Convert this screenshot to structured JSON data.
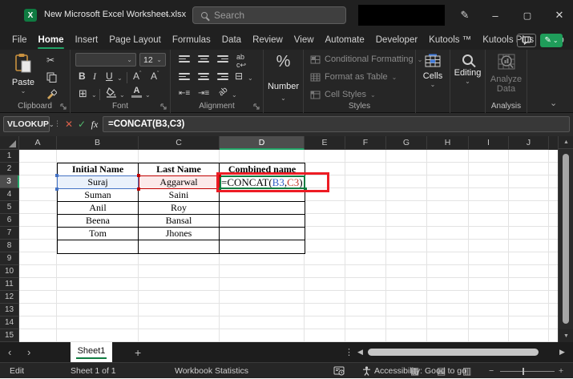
{
  "window": {
    "title": "New Microsoft Excel Worksheet.xlsx",
    "search_placeholder": "Search"
  },
  "menu": {
    "items": [
      "File",
      "Home",
      "Insert",
      "Page Layout",
      "Formulas",
      "Data",
      "Review",
      "View",
      "Automate",
      "Developer",
      "Kutools ™",
      "Kutools Plus",
      "Help"
    ],
    "active": "Home"
  },
  "ribbon": {
    "clipboard": {
      "label": "Clipboard",
      "paste": "Paste"
    },
    "font": {
      "label": "Font",
      "size": "12",
      "bold": "B",
      "italic": "I",
      "underline": "U"
    },
    "alignment": {
      "label": "Alignment"
    },
    "number": {
      "label": "Number",
      "percent": "%"
    },
    "styles": {
      "label": "Styles",
      "items": [
        "Conditional Formatting",
        "Format as Table",
        "Cell Styles"
      ]
    },
    "cells": {
      "label": "Cells"
    },
    "editing": {
      "label": "Editing"
    },
    "analysis": {
      "label": "Analysis",
      "analyze_line1": "Analyze",
      "analyze_line2": "Data"
    }
  },
  "formula_bar": {
    "name_box": "VLOOKUP",
    "fx": "fx",
    "formula": "=CONCAT(B3,C3)"
  },
  "grid": {
    "columns": [
      "A",
      "B",
      "C",
      "D",
      "E",
      "F",
      "G",
      "H",
      "I",
      "J"
    ],
    "selected_column": "D",
    "rows": [
      "1",
      "2",
      "3",
      "4",
      "5",
      "6",
      "7",
      "8",
      "9",
      "10",
      "11",
      "12",
      "13",
      "14",
      "15"
    ],
    "selected_row": "3"
  },
  "table": {
    "headers": [
      "Initial Name",
      "Last Name",
      "Combined name"
    ],
    "rows": [
      [
        "Suraj",
        "Aggarwal"
      ],
      [
        "Suman",
        "Saini"
      ],
      [
        "Anil",
        "Roy"
      ],
      [
        "Beena",
        "Bansal"
      ],
      [
        "Tom",
        "Jhones"
      ],
      [
        "",
        ""
      ]
    ],
    "formula_parts": {
      "prefix": "=CONCAT(",
      "ref1": "B3",
      "comma": ",",
      "ref2": "C3",
      "suffix": ")"
    }
  },
  "sheet_tabs": {
    "active": "Sheet1",
    "add_label": "+"
  },
  "status_bar": {
    "mode": "Edit",
    "sheet_info": "Sheet 1 of 1",
    "workbook_statistics": "Workbook Statistics",
    "accessibility": "Accessibility: Good to go"
  },
  "colors": {
    "accent_green": "#107c41",
    "menu_green": "#21a366",
    "ref_blue": "#2e5cc5",
    "ref_red": "#c0392b",
    "annotation_red": "#ed1c24",
    "b3_fill": "#eaf1fb",
    "b3_border": "#4472c4",
    "c3_fill": "#fceaea",
    "c3_border": "#c00000"
  }
}
